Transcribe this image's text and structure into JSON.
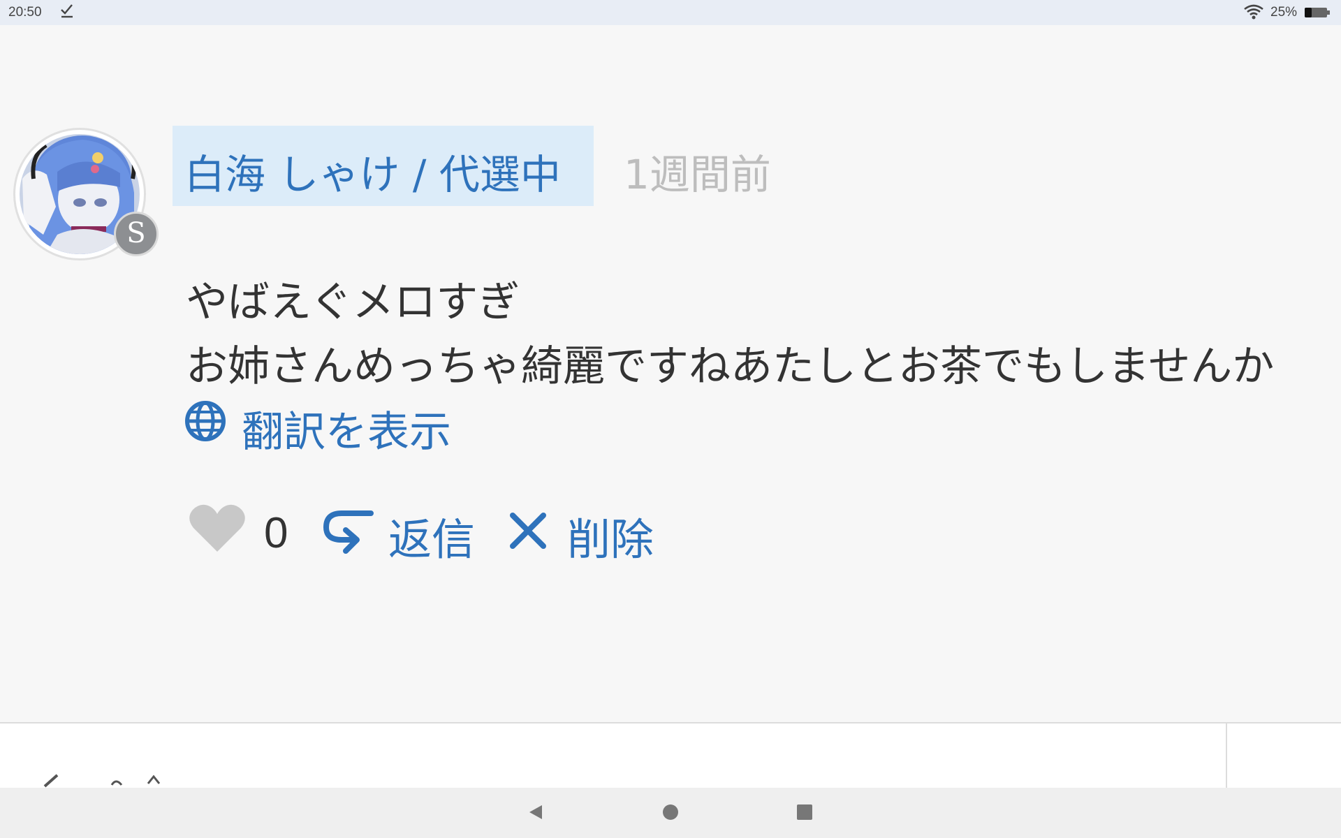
{
  "status_bar": {
    "time": "20:50",
    "battery_percent": "25%",
    "icons": [
      "download-done-icon",
      "wifi-icon",
      "battery-icon"
    ]
  },
  "comment": {
    "username": "白海 しゃけ / 代選中",
    "time_ago": "1週間前",
    "body_lines": [
      "やばえぐメロすぎ",
      "お姉さんめっちゃ綺麗ですねあたしとお茶でもしませんか"
    ],
    "translate_label": "翻訳を表示",
    "like_count": "0",
    "reply_label": "返信",
    "delete_label": "削除",
    "badge_letter": "S"
  },
  "colors": {
    "link_blue": "#2e72bb",
    "username_highlight": "#dcecf9",
    "muted_gray": "#bdbdbd",
    "heart_gray": "#c8c8c8"
  },
  "nav_bar": {
    "buttons": [
      "back-icon",
      "home-icon",
      "recents-icon"
    ]
  }
}
